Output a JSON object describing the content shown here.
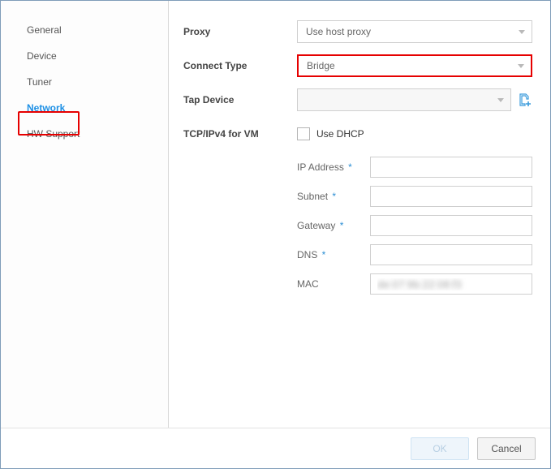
{
  "sidebar": {
    "items": [
      {
        "label": "General"
      },
      {
        "label": "Device"
      },
      {
        "label": "Tuner"
      },
      {
        "label": "Network"
      },
      {
        "label": "HW Support"
      }
    ],
    "selected_index": 3
  },
  "form": {
    "proxy": {
      "label": "Proxy",
      "value": "Use host proxy"
    },
    "connect_type": {
      "label": "Connect Type",
      "value": "Bridge"
    },
    "tap_device": {
      "label": "Tap Device",
      "value": ""
    },
    "tcpip": {
      "label": "TCP/IPv4 for VM",
      "use_dhcp_label": "Use DHCP",
      "use_dhcp_checked": false,
      "ip": {
        "label": "IP Address",
        "required": true,
        "value": ""
      },
      "subnet": {
        "label": "Subnet",
        "required": true,
        "value": ""
      },
      "gateway": {
        "label": "Gateway",
        "required": true,
        "value": ""
      },
      "dns": {
        "label": "DNS",
        "required": true,
        "value": ""
      },
      "mac": {
        "label": "MAC",
        "required": false,
        "value": "de:07:9b:22:08:f3"
      }
    }
  },
  "footer": {
    "ok": "OK",
    "cancel": "Cancel"
  }
}
